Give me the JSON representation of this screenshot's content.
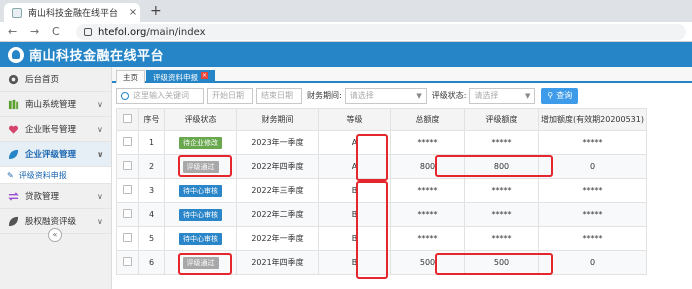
{
  "browser": {
    "tab_title": "南山科技金融在线平台",
    "tab_close": "×",
    "new_tab": "+",
    "nav_back": "←",
    "nav_forward": "→",
    "nav_reload": "C",
    "url_domain": "htefol.org",
    "url_path": "/main/index"
  },
  "app": {
    "title": "南山科技金融在线平台"
  },
  "sidebar": {
    "items": [
      {
        "label": "后台首页",
        "icon": "dashboard-icon",
        "color": "#555555"
      },
      {
        "label": "南山系统管理",
        "icon": "system-icon",
        "color": "#5aa02c"
      },
      {
        "label": "企业账号管理",
        "icon": "heart-icon",
        "color": "#d6456b"
      },
      {
        "label": "企业评级管理",
        "icon": "leaf-icon",
        "color": "#2585c7"
      },
      {
        "label": "贷款管理",
        "icon": "exchange-icon",
        "color": "#9b4dd1"
      },
      {
        "label": "股权融资评级",
        "icon": "leaf-icon",
        "color": "#555555"
      }
    ],
    "sub_item": "评级资料申报",
    "collapse": "«"
  },
  "page_tabs": [
    {
      "label": "主页",
      "active": false
    },
    {
      "label": "评级资料申报",
      "active": true,
      "close": "×"
    }
  ],
  "toolbar": {
    "search_placeholder": "这里输入关键词",
    "start_date_placeholder": "开始日期",
    "end_date_placeholder": "结束日期",
    "period_label": "财务期间:",
    "period_placeholder": "请选择",
    "status_label": "评级状态:",
    "status_placeholder": "请选择",
    "query_button": "查询"
  },
  "table": {
    "headers": [
      "",
      "序号",
      "评级状态",
      "财务期间",
      "等级",
      "总额度",
      "评级额度",
      "增加额度(有效期20200531)"
    ],
    "rows": [
      {
        "no": "1",
        "status": "待企业修改",
        "status_color": "#6aa84f",
        "period": "2023年一季度",
        "grade": "A",
        "total": "*****",
        "rating": "*****",
        "increase": "*****"
      },
      {
        "no": "2",
        "status": "评级通过",
        "status_color": "#a8a8a8",
        "period": "2022年四季度",
        "grade": "A",
        "total": "800",
        "rating": "800",
        "increase": "0"
      },
      {
        "no": "3",
        "status": "待中心审核",
        "status_color": "#2b86c9",
        "period": "2022年三季度",
        "grade": "B",
        "total": "*****",
        "rating": "*****",
        "increase": "*****"
      },
      {
        "no": "4",
        "status": "待中心审核",
        "status_color": "#2b86c9",
        "period": "2022年二季度",
        "grade": "B",
        "total": "*****",
        "rating": "*****",
        "increase": "*****"
      },
      {
        "no": "5",
        "status": "待中心审核",
        "status_color": "#2b86c9",
        "period": "2022年一季度",
        "grade": "B",
        "total": "*****",
        "rating": "*****",
        "increase": "*****"
      },
      {
        "no": "6",
        "status": "评级通过",
        "status_color": "#a8a8a8",
        "period": "2021年四季度",
        "grade": "B",
        "total": "500",
        "rating": "500",
        "increase": "0"
      }
    ]
  },
  "accent_color": "#2585c7",
  "highlight_color": "#e6262d"
}
